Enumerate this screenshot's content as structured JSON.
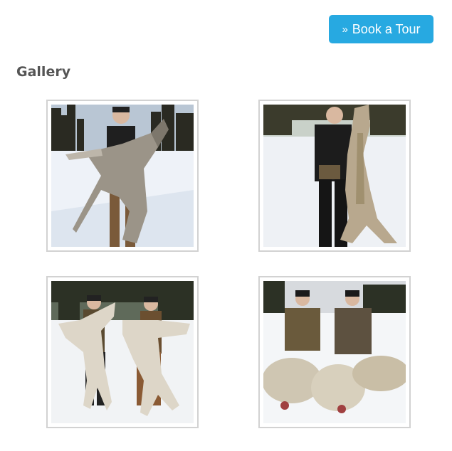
{
  "header": {
    "book_tour_icon": "double-chevron-right-icon",
    "book_tour_glyph": "»",
    "book_tour_label": "Book a Tour"
  },
  "gallery": {
    "title": "Gallery",
    "photos": [
      {
        "subject": "hunter-holding-wolf-1"
      },
      {
        "subject": "hunter-holding-wolf-2"
      },
      {
        "subject": "two-hunters-holding-wolves"
      },
      {
        "subject": "two-hunters-with-wolves-on-snow"
      }
    ]
  },
  "colors": {
    "accent": "#27a9e1",
    "thumb_border": "#d2d2d2",
    "heading": "#555555"
  }
}
